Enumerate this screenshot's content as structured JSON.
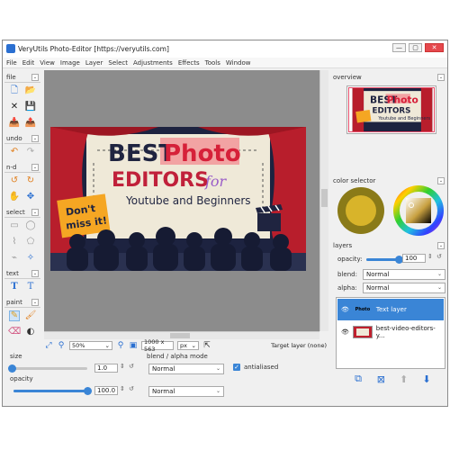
{
  "window": {
    "title": "VeryUtils Photo-Editor [https://veryutils.com]",
    "controls": [
      "—",
      "▢",
      "✕"
    ]
  },
  "menu": [
    "File",
    "Edit",
    "View",
    "Image",
    "Layer",
    "Select",
    "Adjustments",
    "Effects",
    "Tools",
    "Window"
  ],
  "toolbox": {
    "sections": {
      "file": "file",
      "undo": "undo",
      "nd": "n-d",
      "select": "select",
      "text": "text",
      "paint": "paint"
    },
    "icons": {
      "new": "🗋",
      "open": "📂",
      "close": "✕",
      "save": "💾",
      "import": "📥",
      "export": "📤",
      "undo": "↶",
      "redo": "↷",
      "rotate_left": "↺",
      "rotate_right": "↻",
      "pan": "✋",
      "move": "✥",
      "sel_rect": "▭",
      "sel_ellipse": "◯",
      "sel_lasso": "⌇",
      "sel_poly": "⬠",
      "sel_magic": "⌁",
      "sel_wand": "✧",
      "text_a": "T",
      "text_b": "T",
      "pencil": "✎",
      "brush": "🖌",
      "eraser": "⌫",
      "fill": "◐"
    }
  },
  "image": {
    "best": "BEST",
    "photo": "Photo",
    "editors": "EDITORS",
    "for": "for",
    "line2": "Youtube and Beginners",
    "badge_line1": "Don't",
    "badge_line2": "miss it!"
  },
  "statusbar": {
    "zoom": "50%",
    "size": "1000 x 563",
    "unit": "px",
    "target": "Target layer (none)"
  },
  "bottom": {
    "size_label": "size",
    "size_value": "1.0",
    "opacity_label": "opacity",
    "opacity_value": "100.0",
    "opacity_fraction": 1.0,
    "blend_label": "blend / alpha mode",
    "blend_value": "Normal",
    "alpha_value": "Normal",
    "antialiased_label": "antialiased"
  },
  "right": {
    "overview": "overview",
    "color_selector": "color selector",
    "layers": "layers",
    "opacity_label": "opacity:",
    "opacity_value": "100",
    "opacity_fraction": 1.0,
    "blend_label": "blend:",
    "blend_value": "Normal",
    "alpha_label": "alpha:",
    "alpha_value": "Normal",
    "layer_items": [
      {
        "name": "Text layer",
        "thumb": "Photo",
        "selected": true
      },
      {
        "name": "best-video-editors-y...",
        "thumb": "",
        "selected": false
      }
    ]
  },
  "colors": {
    "accent": "#3a85d6",
    "curtain": "#c0202e",
    "headline": "#1f2440",
    "photo_bg": "#f2a3a3",
    "badge": "#f5a623"
  }
}
